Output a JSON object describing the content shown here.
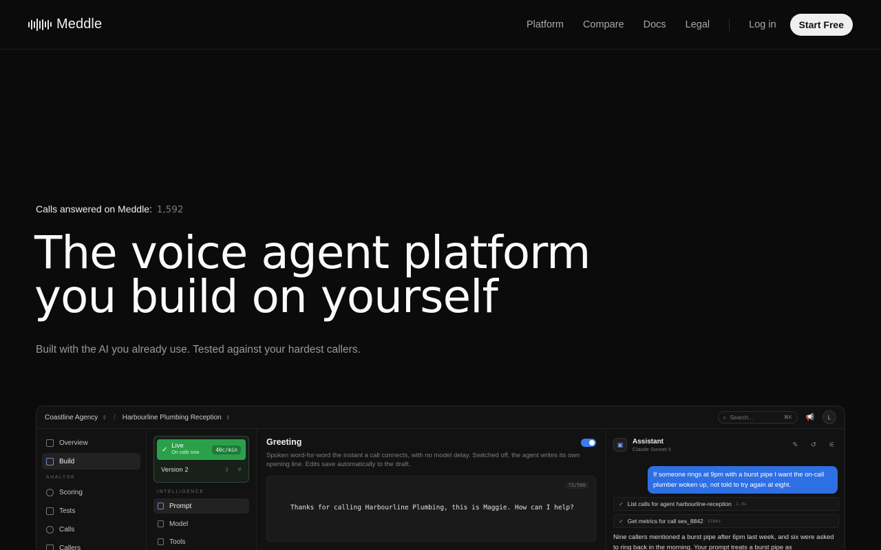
{
  "nav": {
    "brand": "Meddle",
    "links": [
      "Platform",
      "Compare",
      "Docs",
      "Legal"
    ],
    "login": "Log in",
    "cta": "Start Free"
  },
  "hero": {
    "calls_label": "Calls answered on Meddle:",
    "calls_count": "1,592",
    "title_line1": "The voice agent platform",
    "title_line2": "you build on yourself",
    "subtitle": "Built with the AI you already use. Tested against your hardest callers."
  },
  "app": {
    "breadcrumb": [
      "Coastline Agency",
      "Harbourline Plumbing Reception"
    ],
    "search_placeholder": "Search...",
    "search_shortcut": "⌘K",
    "avatar": "L",
    "sidebar": {
      "items_top": [
        "Overview",
        "Build"
      ],
      "section": "ANALYSE",
      "items_analyse": [
        "Scoring",
        "Tests",
        "Calls",
        "Callers"
      ]
    },
    "status": {
      "live_label": "Live",
      "live_sub": "On calls now",
      "rate": "40c/min",
      "version": "Version 2"
    },
    "intelligence": {
      "section": "INTELLIGENCE",
      "items": [
        "Prompt",
        "Model",
        "Tools"
      ]
    },
    "greeting": {
      "title": "Greeting",
      "description": "Spoken word-for-word the instant a call connects, with no model delay. Switched off, the agent writes its own opening line. Edits save automatically to the draft.",
      "char_count": "72/500",
      "text": "Thanks for calling Harbourline Plumbing, this is Maggie. How can I help?"
    },
    "assistant": {
      "name": "Assistant",
      "model": "Claude Sonnet 5",
      "user_message": "If someone rings at 9pm with a burst pipe I want the on-call plumber woken up, not told to try again at eight.",
      "tools": [
        {
          "label": "List calls for agent harbourline-reception",
          "time": "1.4s"
        },
        {
          "label": "Get metrics for call ses_8842",
          "time": "310ms"
        }
      ],
      "reply": "Nine callers mentioned a burst pipe after 6pm last week, and six were asked to ring back in the morning. Your prompt treats a burst pipe as"
    }
  },
  "colors": {
    "accent_blue": "#2f6fe4",
    "live_green": "#2ba04a",
    "background": "#0b0b0b"
  }
}
